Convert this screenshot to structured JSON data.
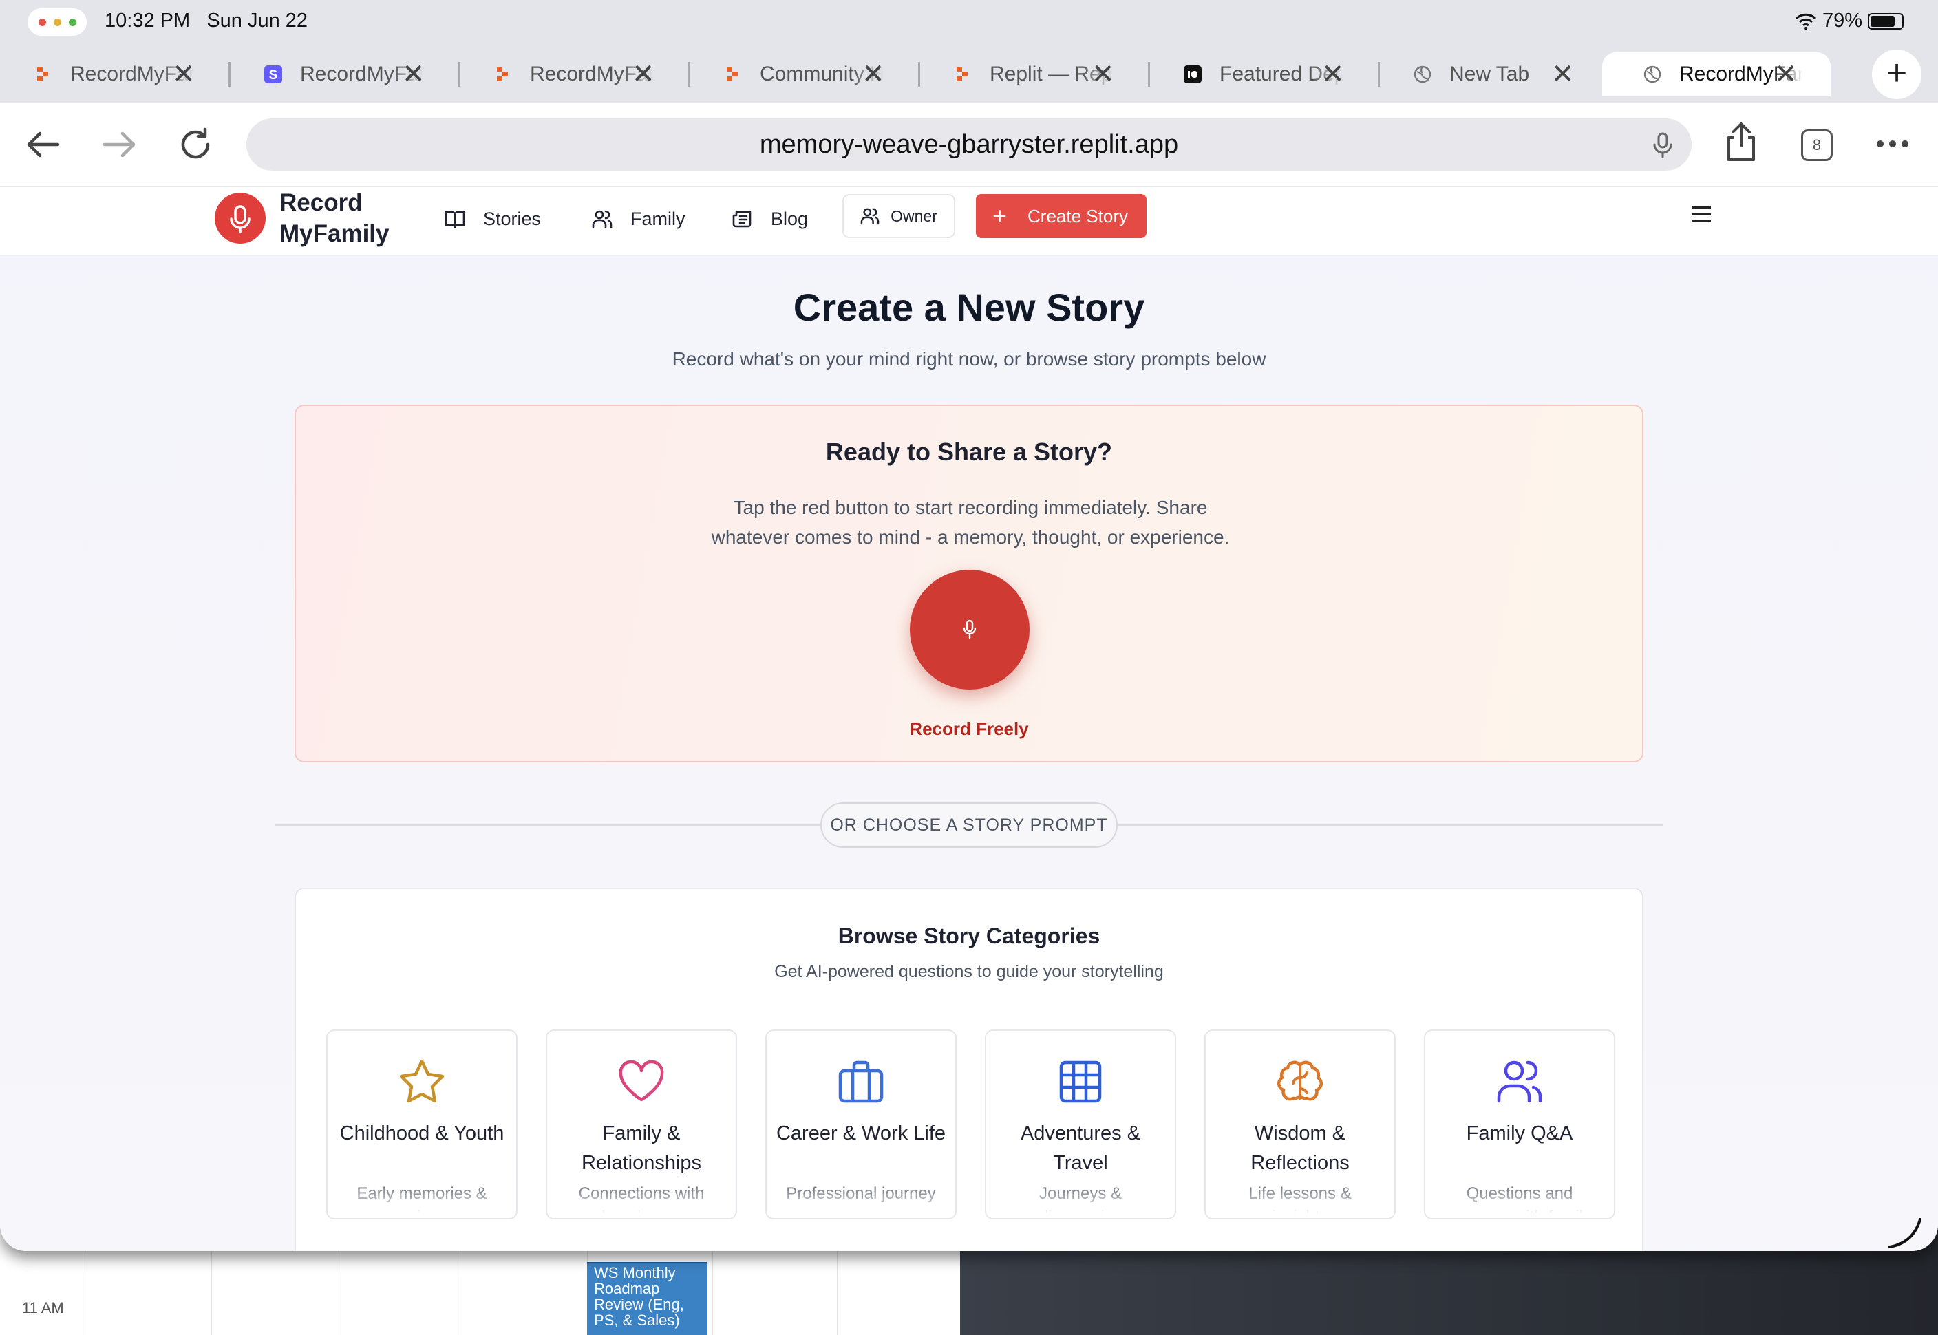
{
  "status_bar": {
    "time": "10:32 PM",
    "date": "Sun Jun 22",
    "battery": "79%",
    "battery_level": 0.79
  },
  "tabs": [
    {
      "title": "RecordMyFamily",
      "icon": "replit-icon"
    },
    {
      "title": "RecordMyFamily",
      "icon": "stripe-icon"
    },
    {
      "title": "RecordMyFamily",
      "icon": "replit-icon"
    },
    {
      "title": "Community Hub",
      "icon": "replit-icon"
    },
    {
      "title": "Replit — Replit",
      "icon": "replit-icon"
    },
    {
      "title": "Featured Deployments",
      "icon": "deploy-icon"
    },
    {
      "title": "New Tab",
      "icon": "globe-icon"
    },
    {
      "title": "RecordMyFamily",
      "icon": "globe-icon",
      "active": true
    }
  ],
  "toolbar": {
    "url": "memory-weave-gbarryster.replit.app",
    "tab_count": "8"
  },
  "site": {
    "logo_line1": "Record",
    "logo_line2": "MyFamily",
    "nav": {
      "stories": "Stories",
      "family": "Family",
      "blog": "Blog",
      "owner": "Owner",
      "create_story": "Create Story"
    },
    "title": "Create a New Story",
    "subtitle": "Record what's on your mind right now, or browse story prompts below",
    "ready": {
      "title": "Ready to Share a Story?",
      "text": "Tap the red button to start recording immediately. Share whatever comes to mind - a memory, thought, or experience.",
      "button_label": "Record Freely"
    },
    "divider_label": "OR CHOOSE A STORY PROMPT",
    "browse": {
      "title": "Browse Story Categories",
      "subtitle": "Get AI-powered questions to guide your storytelling",
      "categories": [
        {
          "name": "Childhood & Youth",
          "desc": "Early memories & growing up",
          "icon": "star-icon",
          "color": "#c8922a"
        },
        {
          "name": "Family & Relationships",
          "desc": "Connections with loved ones",
          "icon": "heart-icon",
          "color": "#d9467e"
        },
        {
          "name": "Career & Work Life",
          "desc": "Professional journey",
          "icon": "briefcase-icon",
          "color": "#3b6fd8"
        },
        {
          "name": "Adventures & Travel",
          "desc": "Journeys & discoveries",
          "icon": "grid-icon",
          "color": "#2f5fd6"
        },
        {
          "name": "Wisdom & Reflections",
          "desc": "Life lessons & insights",
          "icon": "brain-icon",
          "color": "#d9782a"
        },
        {
          "name": "Family Q&A",
          "desc": "Questions and answers with family",
          "icon": "users-icon",
          "color": "#4f46e5"
        }
      ]
    }
  },
  "background": {
    "calendar_time": "11 AM",
    "calendar_event": "WS Monthly Roadmap Review (Eng, PS, & Sales)"
  },
  "colors": {
    "accent": "#e44b44",
    "record_button": "#cf3a32",
    "record_label": "#b3261e"
  }
}
